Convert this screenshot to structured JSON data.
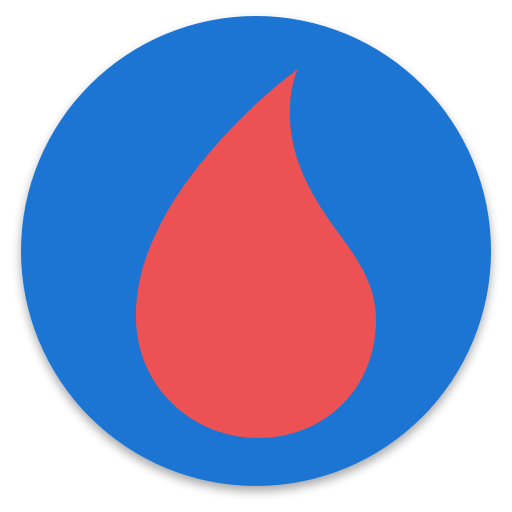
{
  "icon": {
    "name": "blood-drop-icon",
    "colors": {
      "circle": "#1C75D2",
      "drop": "#EC5254",
      "shadow": "#000000"
    }
  }
}
